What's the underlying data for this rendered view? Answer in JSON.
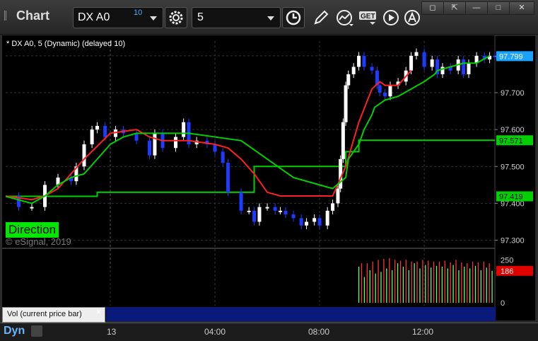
{
  "app": {
    "title": "Chart"
  },
  "toolbar": {
    "symbol": "DX A0",
    "symbol_sup": "10",
    "interval": "5",
    "icons": [
      "gear-icon",
      "clock-icon",
      "pencil-icon",
      "study-icon",
      "get-icon",
      "play-icon",
      "alert-icon"
    ]
  },
  "window_buttons": [
    "restore",
    "link",
    "minimize",
    "maximize",
    "close"
  ],
  "legend": "* DX A0, 5 (Dynamic) (delayed 10)",
  "direction_label": "Direction",
  "copyright": "© eSignal, 2019",
  "volume_pane": {
    "label": "Vol (current price bar)",
    "close": "×"
  },
  "footer": {
    "mode": "Dyn"
  },
  "price_axis": {
    "ticks": [
      "97.799",
      "97.700",
      "97.600",
      "97.500",
      "97.400",
      "97.300"
    ],
    "tags": [
      {
        "label": "97.799",
        "color": "#1ba1ff",
        "text_color": "#ffffff"
      },
      {
        "label": "97.571",
        "color": "#00d000",
        "text_color": "#000000"
      },
      {
        "label": "97.419",
        "color": "#00d000",
        "text_color": "#000000"
      }
    ]
  },
  "volume_axis": {
    "ticks": [
      "250",
      "0"
    ],
    "tag": {
      "label": "186",
      "color": "#e00000",
      "text_color": "#ffffff"
    }
  },
  "time_axis": {
    "ticks": [
      "13",
      "04:00",
      "08:00",
      "12:00"
    ]
  },
  "colors": {
    "up": "#ffffff",
    "down": "#1e3cff",
    "avg_red": "#ff2020",
    "avg_green": "#00d000",
    "background": "#000000"
  },
  "chart_data": {
    "type": "line",
    "ylim": [
      97.28,
      97.84
    ],
    "x_range": [
      0,
      187
    ],
    "time_ticks_at": {
      "13": 40,
      "04:00": 80,
      "08:00": 120,
      "12:00": 160
    },
    "price": {
      "x": [
        0,
        5,
        10,
        15,
        20,
        25,
        27,
        30,
        33,
        35,
        38,
        42,
        45,
        50,
        55,
        57,
        60,
        65,
        68,
        70,
        73,
        77,
        80,
        83,
        85,
        90,
        93,
        95,
        97,
        100,
        103,
        105,
        107,
        110,
        113,
        115,
        118,
        120,
        123,
        125,
        127,
        128,
        129,
        130,
        131,
        133,
        135,
        137,
        140,
        142,
        143,
        145,
        147,
        150,
        153,
        155,
        157,
        160,
        163,
        165,
        167,
        170,
        173,
        175,
        177,
        180,
        183,
        185,
        187
      ],
      "y": [
        97.42,
        97.39,
        97.39,
        97.45,
        97.47,
        97.46,
        97.5,
        97.56,
        97.6,
        97.61,
        97.58,
        97.6,
        97.59,
        97.57,
        97.53,
        97.59,
        97.55,
        97.58,
        97.62,
        97.56,
        97.57,
        97.56,
        97.54,
        97.51,
        97.43,
        97.38,
        97.38,
        97.35,
        97.39,
        97.39,
        97.38,
        97.38,
        97.37,
        97.36,
        97.34,
        97.35,
        97.36,
        97.34,
        97.38,
        97.4,
        97.44,
        97.52,
        97.62,
        97.72,
        97.75,
        97.77,
        97.8,
        97.77,
        97.76,
        97.72,
        97.7,
        97.69,
        97.72,
        97.73,
        97.76,
        97.8,
        97.81,
        97.77,
        97.79,
        97.75,
        97.77,
        97.76,
        97.79,
        97.75,
        97.78,
        97.8,
        97.79,
        97.8,
        97.799
      ]
    },
    "red_average": {
      "x": [
        0,
        10,
        15,
        20,
        30,
        40,
        50,
        55,
        60,
        65,
        70,
        80,
        85,
        90,
        95,
        100,
        105,
        110,
        115,
        120,
        125,
        130,
        135,
        140,
        143,
        145,
        150,
        155
      ],
      "y": [
        97.42,
        97.41,
        97.42,
        97.44,
        97.52,
        97.59,
        97.6,
        97.58,
        97.57,
        97.57,
        97.57,
        97.56,
        97.55,
        97.52,
        97.48,
        97.43,
        97.42,
        97.42,
        97.42,
        97.42,
        97.42,
        97.5,
        97.62,
        97.71,
        97.73,
        97.72,
        97.72,
        97.76
      ]
    },
    "green_average": {
      "x": [
        0,
        10,
        15,
        20,
        25,
        30,
        35,
        40,
        45,
        50,
        55,
        60,
        70,
        80,
        90,
        100,
        110,
        120,
        125,
        130,
        131,
        135,
        137,
        140,
        141,
        145,
        150,
        155,
        160,
        164,
        165,
        170,
        175,
        180,
        185
      ],
      "y": [
        97.419,
        97.4,
        97.42,
        97.45,
        97.47,
        97.48,
        97.52,
        97.56,
        97.58,
        97.59,
        97.59,
        97.59,
        97.59,
        97.58,
        97.57,
        97.52,
        97.47,
        97.45,
        97.44,
        97.47,
        97.52,
        97.56,
        97.6,
        97.64,
        97.66,
        97.68,
        97.69,
        97.71,
        97.73,
        97.75,
        97.76,
        97.77,
        97.78,
        97.78,
        97.8
      ]
    },
    "step_lines": [
      {
        "color": "#00d000",
        "x": [
          0,
          15,
          15,
          35,
          35,
          95,
          95,
          130,
          130,
          135,
          135,
          164,
          164,
          187
        ],
        "y": [
          97.419,
          97.419,
          97.419,
          97.419,
          97.43,
          97.43,
          97.5,
          97.5,
          97.54,
          97.54,
          97.571,
          97.571,
          97.571,
          97.571
        ]
      }
    ],
    "volume": {
      "ylim": [
        0,
        280
      ],
      "x_start": 135,
      "values": [
        210,
        230,
        150,
        230,
        190,
        240,
        170,
        250,
        180,
        255,
        200,
        260,
        190,
        250,
        230,
        245,
        210,
        250,
        190,
        240,
        230,
        240,
        200,
        250,
        220,
        245,
        205,
        240,
        215,
        240,
        210,
        245,
        200,
        235,
        220,
        250,
        190,
        235,
        210,
        230,
        200,
        240,
        215,
        235,
        190,
        240,
        205,
        230,
        186
      ],
      "colors_pattern": [
        "#66ff66",
        "#ff3333"
      ]
    }
  }
}
